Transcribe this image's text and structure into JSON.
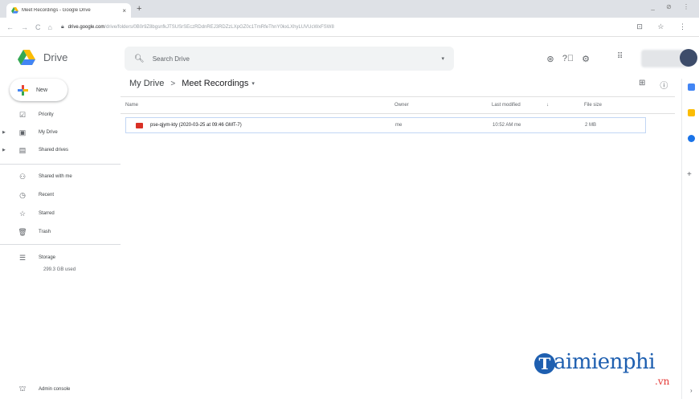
{
  "browser": {
    "tab_title": "Meet Recordings - Google Drive",
    "tab_close": "×",
    "new_tab": "+",
    "window_controls": "_ ⊘ ⋮",
    "nav_back": "←",
    "nav_forward": "→",
    "nav_reload": "C",
    "nav_home": "⌂",
    "url_host": "drive.google.com",
    "url_path": "/drive/folders/0B0r9Z8bgsnfkJTSUSrSEczRDdnREJ3RDZzLXpGZ0c1TmRfeThnY0kxLXhyLUVUcWxFSW8",
    "addr_icons": "⊡ ☆ ⋮"
  },
  "header": {
    "brand": "Drive",
    "search_placeholder": "Search Drive",
    "search_dropdown": "▾",
    "icons": [
      "support-icon",
      "help-icon",
      "settings-icon"
    ],
    "apps_glyph": "⋮⋮⋮"
  },
  "sidebar": {
    "new_label": "New",
    "items": [
      {
        "label": "Priority",
        "icon": "☑",
        "name": "priority"
      },
      {
        "label": "My Drive",
        "icon": "▣",
        "name": "my-drive"
      },
      {
        "label": "Shared drives",
        "icon": "▤",
        "name": "shared-drives"
      },
      {
        "label": "Shared with me",
        "icon": "⚇",
        "name": "shared-with-me"
      },
      {
        "label": "Recent",
        "icon": "◷",
        "name": "recent"
      },
      {
        "label": "Starred",
        "icon": "☆",
        "name": "starred"
      },
      {
        "label": "Trash",
        "icon": "🗑",
        "name": "trash"
      },
      {
        "label": "Storage",
        "icon": "☰",
        "name": "storage"
      }
    ],
    "storage_used": "299.3 GB used",
    "admin_label": "Admin console",
    "admin_icon": "⛫"
  },
  "breadcrumb": {
    "root": "My Drive",
    "sep": ">",
    "current": "Meet Recordings",
    "dropdown": "▾"
  },
  "view_icons": {
    "grid": "⊞",
    "info": "ⓘ"
  },
  "table": {
    "columns": {
      "name": "Name",
      "owner": "Owner",
      "modified": "Last modified",
      "sort": "↓",
      "size": "File size"
    },
    "rows": [
      {
        "name": "pse-qjym-kty (2020-03-25 at 09:46 GMT-7)",
        "owner": "me",
        "modified": "10:52 AM me",
        "size": "2 MB"
      }
    ]
  },
  "watermark": {
    "initial": "T",
    "text": "aimienphi",
    "suffix": ".vn"
  },
  "right_panel": {
    "add": "+",
    "chevron": "›"
  },
  "colors": {
    "accent_blue": "#1a73e8",
    "file_red": "#d93025",
    "watermark_blue": "#1e5fb0",
    "watermark_red": "#e53935"
  }
}
